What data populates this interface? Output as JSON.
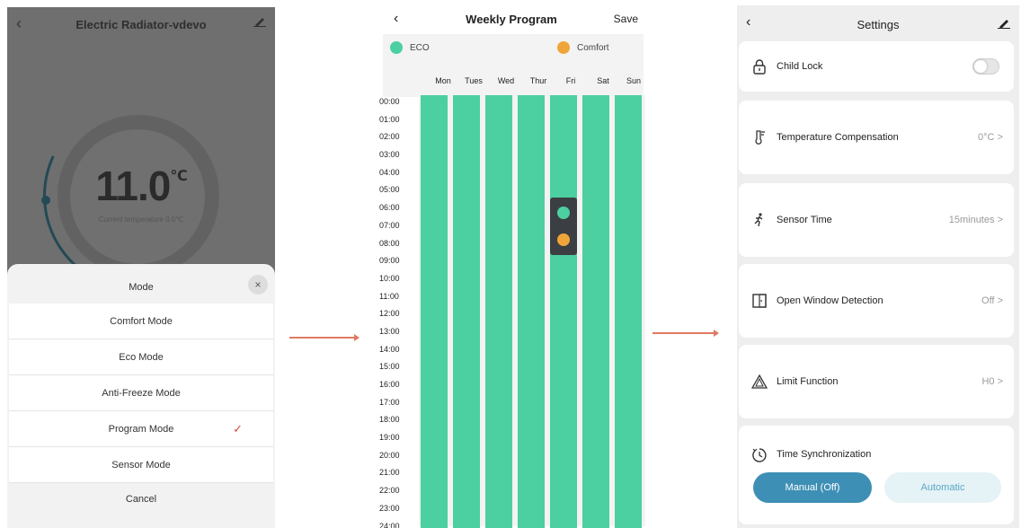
{
  "panel1": {
    "header_title": "Electric Radiator-vdevo",
    "back_icon": "‹",
    "temperature": "11.0",
    "temperature_unit": "℃",
    "current_temp_label": "Current temperature 0.0℃",
    "sheet_title": "Mode",
    "close_label": "×",
    "modes": [
      {
        "label": "Comfort Mode",
        "selected": false
      },
      {
        "label": "Eco Mode",
        "selected": false
      },
      {
        "label": "Anti-Freeze Mode",
        "selected": false
      },
      {
        "label": "Program Mode",
        "selected": true
      },
      {
        "label": "Sensor Mode",
        "selected": false
      }
    ],
    "check_mark": "✓",
    "cancel_label": "Cancel"
  },
  "panel2": {
    "back_icon": "‹",
    "title": "Weekly Program",
    "save_label": "Save",
    "legend_eco": "ECO",
    "legend_comfort": "Comfort",
    "days": [
      "Mon",
      "Tues",
      "Wed",
      "Thur",
      "Fri",
      "Sat",
      "Sun"
    ],
    "hours": [
      "00:00",
      "01:00",
      "02:00",
      "03:00",
      "04:00",
      "05:00",
      "06:00",
      "07:00",
      "08:00",
      "09:00",
      "10:00",
      "11:00",
      "12:00",
      "13:00",
      "14:00",
      "15:00",
      "16:00",
      "17:00",
      "18:00",
      "19:00",
      "20:00",
      "21:00",
      "22:00",
      "23:00",
      "24:00"
    ],
    "colors": {
      "eco": "#4ccfa1",
      "comfort": "#f0a53a"
    }
  },
  "panel3": {
    "back_icon": "‹",
    "title": "Settings",
    "child_lock": {
      "label": "Child Lock",
      "enabled": false
    },
    "temp_compensation": {
      "label": "Temperature Compensation",
      "value": "0°C"
    },
    "sensor_time": {
      "label": "Sensor Time",
      "value": "15minutes"
    },
    "open_window": {
      "label": "Open Window Detection",
      "value": "Off"
    },
    "limit_function": {
      "label": "Limit Function",
      "value": "H0"
    },
    "time_sync": {
      "label": "Time Synchronization",
      "manual_label": "Manual (Off)",
      "automatic_label": "Automatic"
    },
    "chevron": ">"
  }
}
